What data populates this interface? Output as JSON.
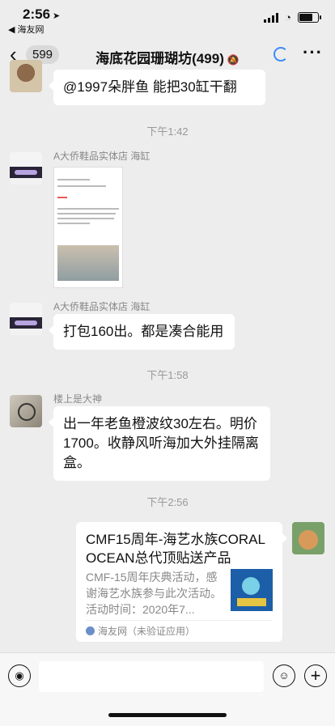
{
  "status": {
    "time": "2:56",
    "back_app": "◀ 海友网"
  },
  "nav": {
    "unread": "599",
    "title": "海底花园珊瑚坊(499)"
  },
  "messages": {
    "m0": "@1997朵胖鱼 能把30缸干翻",
    "ts1": "下午1:42",
    "s1": "A大侨鞋品实体店 海缸",
    "s2": "A大侨鞋品实体店 海缸",
    "m2": "打包160出。都是凑合能用",
    "ts2": "下午1:58",
    "s3": "楼上是大神",
    "m3": "出一年老鱼橙波纹30左右。明价1700。收静风听海加大外挂隔离盒。",
    "ts3": "下午2:56"
  },
  "card": {
    "title": "CMF15周年-海艺水族CORAL OCEAN总代顶贴送产品",
    "desc": "CMF-15周年庆典活动，感谢海艺水族参与此次活动。活动时间：2020年7...",
    "source": "海友网（未验证应用）"
  },
  "icons": [
    "back-arrow-icon",
    "mute-icon",
    "more-icon",
    "voice-icon",
    "emoji-icon",
    "plus-icon"
  ]
}
